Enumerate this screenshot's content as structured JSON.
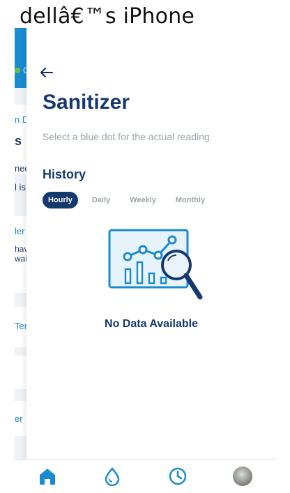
{
  "window": {
    "title": "dellâ€™s iPhone"
  },
  "background": {
    "dot_letter": "C",
    "text_1": "n D",
    "text_2": "s",
    "text_3": "ned",
    "text_4": "l is",
    "text_5": "ler",
    "text_6": "have",
    "text_7": "wait",
    "text_8": "Tem",
    "text_9": "er"
  },
  "header": {
    "back_icon": "arrow-left-icon"
  },
  "page": {
    "title": "Sanitizer",
    "subtitle": "Select a blue dot for the actual reading."
  },
  "history": {
    "title": "History",
    "tabs": [
      {
        "label": "Hourly",
        "active": true
      },
      {
        "label": "Daily",
        "active": false
      },
      {
        "label": "Weekly",
        "active": false
      },
      {
        "label": "Monthly",
        "active": false
      }
    ],
    "empty_icon": "chart-magnifier-icon",
    "empty_text": "No Data Available"
  },
  "bottom_nav": {
    "items": [
      {
        "icon": "home-icon",
        "color": "#1a8bd0"
      },
      {
        "icon": "water-drop-icon",
        "color": "#1a8bd0"
      },
      {
        "icon": "clock-icon",
        "color": "#1a8bd0"
      },
      {
        "icon": "avatar-icon"
      }
    ]
  },
  "colors": {
    "primary_navy": "#16396d",
    "accent_blue": "#1a8bd0",
    "muted_gray": "#9aa3ae",
    "status_green": "#6cc04a"
  }
}
